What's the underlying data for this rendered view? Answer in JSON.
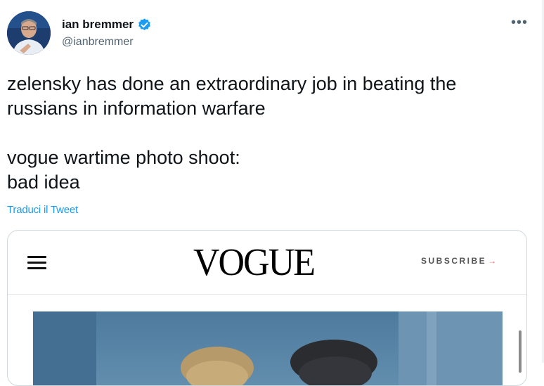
{
  "tweet": {
    "author_name": "ian bremmer",
    "author_handle": "@ianbremmer",
    "verified": true,
    "more_icon": "more-horizontal-icon",
    "text_lines_1": [
      "zelensky has done an extraordinary job in beating the",
      "russians in information warfare"
    ],
    "text_lines_2": [
      "vogue wartime photo shoot:",
      "bad idea"
    ],
    "translate_label": "Traduci il Tweet"
  },
  "embed": {
    "logo": "VOGUE",
    "subscribe_label": "SUBSCRIBE",
    "subscribe_arrow": "→",
    "menu_icon": "hamburger-menu-icon"
  },
  "colors": {
    "link": "#1d9bf0",
    "verified_badge": "#1d9bf0",
    "text": "#0f1419",
    "secondary": "#536471"
  }
}
